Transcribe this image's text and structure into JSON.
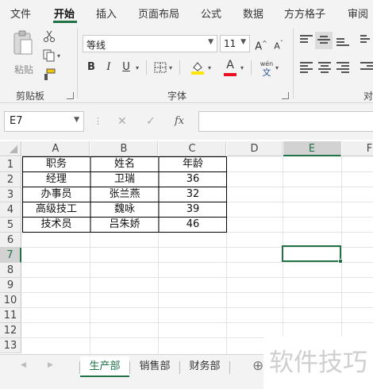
{
  "menu": {
    "tabs": [
      {
        "label": "文件"
      },
      {
        "label": "开始"
      },
      {
        "label": "插入"
      },
      {
        "label": "页面布局"
      },
      {
        "label": "公式"
      },
      {
        "label": "数据"
      },
      {
        "label": "方方格子"
      },
      {
        "label": "审阅"
      }
    ],
    "active": "开始"
  },
  "ribbon": {
    "clipboard": {
      "paste_label": "粘贴",
      "group_label": "剪贴板"
    },
    "font": {
      "font_name": "等线",
      "font_size": "11",
      "group_label": "字体",
      "bold": "B",
      "italic": "I",
      "underline": "U",
      "grow": "A",
      "shrink": "A",
      "font_color_letter": "A",
      "phonetic_top": "wén",
      "phonetic_bottom": "文"
    },
    "align": {
      "group_label": "对"
    },
    "colors": {
      "accent": "#217346",
      "fill_yellow": "#ffe600",
      "font_red": "#e81123"
    }
  },
  "formula_bar": {
    "name_box": "E7",
    "fx": "fx",
    "cancel": "✕",
    "enter": "✓",
    "formula": ""
  },
  "grid": {
    "columns": [
      "A",
      "B",
      "C",
      "D",
      "E",
      "F"
    ],
    "rows": [
      "1",
      "2",
      "3",
      "4",
      "5",
      "6",
      "7",
      "8",
      "9",
      "10",
      "11",
      "12",
      "13"
    ],
    "selected_cell": "E7",
    "table": {
      "headers": [
        "职务",
        "姓名",
        "年龄"
      ],
      "rows": [
        [
          "经理",
          "卫瑞",
          "36"
        ],
        [
          "办事员",
          "张兰燕",
          "32"
        ],
        [
          "高级技工",
          "魏咏",
          "39"
        ],
        [
          "技术员",
          "吕朱娇",
          "46"
        ]
      ]
    }
  },
  "sheets": {
    "tabs": [
      {
        "label": "生产部"
      },
      {
        "label": "销售部"
      },
      {
        "label": "财务部"
      }
    ],
    "active": "生产部",
    "add": "⊕"
  },
  "watermark": "软件技巧"
}
